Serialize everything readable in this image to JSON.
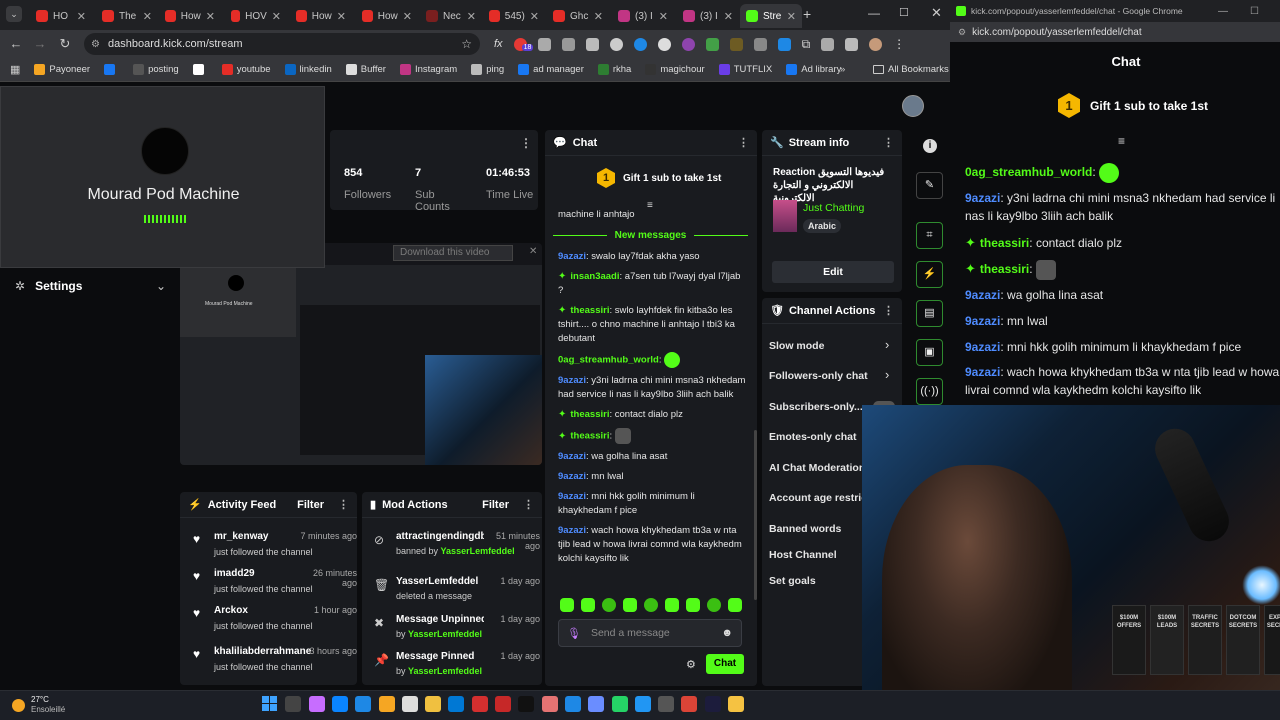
{
  "browser": {
    "tabs": [
      {
        "label": "HO",
        "color": "#e52d27"
      },
      {
        "label": "The",
        "color": "#e52d27"
      },
      {
        "label": "How",
        "color": "#e52d27"
      },
      {
        "label": "HOV",
        "color": "#e52d27"
      },
      {
        "label": "How",
        "color": "#e52d27"
      },
      {
        "label": "How",
        "color": "#e52d27"
      },
      {
        "label": "Nec",
        "color": "#7a1f1f"
      },
      {
        "label": "545)",
        "color": "#e52d27"
      },
      {
        "label": "Ghc",
        "color": "#e52d27"
      },
      {
        "label": "(3) I",
        "color": "#c13584"
      },
      {
        "label": "(3) I",
        "color": "#c13584"
      },
      {
        "label": "Stre",
        "color": "#53fc18"
      }
    ],
    "url": "dashboard.kick.com/stream",
    "bookmarks": [
      {
        "label": "Payoneer",
        "color": "#f5a623"
      },
      {
        "label": "",
        "color": "#1877f2"
      },
      {
        "label": "posting",
        "color": "#555"
      },
      {
        "label": "",
        "color": "#fff"
      },
      {
        "label": "youtube",
        "color": "#e52d27"
      },
      {
        "label": "linkedin",
        "color": "#0a66c2"
      },
      {
        "label": "Buffer",
        "color": "#ddd"
      },
      {
        "label": "Instagram",
        "color": "#c13584"
      },
      {
        "label": "ping",
        "color": "#bbb"
      },
      {
        "label": "ad manager",
        "color": "#1877f2"
      },
      {
        "label": "rkha",
        "color": "#2e7d32"
      },
      {
        "label": "magichour",
        "color": "#333"
      },
      {
        "label": "TUTFLIX",
        "color": "#6a3de8"
      },
      {
        "label": "Ad library",
        "color": "#1877f2"
      }
    ],
    "all_bookmarks": "All Bookmarks",
    "ext_badge": "18"
  },
  "overlay": {
    "name": "Mourad Pod Machine",
    "settings": "Settings"
  },
  "stats": [
    {
      "value": "854",
      "label": "Followers"
    },
    {
      "value": "7",
      "label": "Sub Counts"
    },
    {
      "value": "01:46:53",
      "label": "Time Live"
    }
  ],
  "preview": {
    "download": "Download this video"
  },
  "chat": {
    "title": "Chat",
    "gift": "Gift 1 sub to take 1st",
    "gift_rank": "1",
    "cut_line": "machine li anhtajo",
    "new_messages": "New messages",
    "messages": [
      {
        "user": "9azazi",
        "color": "#4f8cff",
        "badge": false,
        "text": "swalo lay7fdak akha yaso"
      },
      {
        "user": "insan3aadi",
        "color": "#53fc18",
        "badge": true,
        "text": "a7sen tub l7wayj dyal l7ljab ?"
      },
      {
        "user": "theassiri",
        "color": "#53fc18",
        "badge": true,
        "text": "swlo layhfdek fin kitba3o les tshirt.... o chno machine li anhtajo l tbi3 ka debutant"
      },
      {
        "user": "0ag_streamhub_world",
        "color": "#53fc18",
        "badge": false,
        "text": ""
      },
      {
        "user": "9azazi",
        "color": "#4f8cff",
        "badge": false,
        "text": "y3ni ladrna chi mini msna3 nkhedam had service li nas li kay9lbo 3liih ach balik"
      },
      {
        "user": "theassiri",
        "color": "#53fc18",
        "badge": true,
        "text": "contact dialo plz"
      },
      {
        "user": "theassiri",
        "color": "#53fc18",
        "badge": true,
        "text": ""
      },
      {
        "user": "9azazi",
        "color": "#4f8cff",
        "badge": false,
        "text": "wa golha lina asat"
      },
      {
        "user": "9azazi",
        "color": "#4f8cff",
        "badge": false,
        "text": "mn lwal"
      },
      {
        "user": "9azazi",
        "color": "#4f8cff",
        "badge": false,
        "text": "mni hkk golih minimum li khaykhedam f pice"
      },
      {
        "user": "9azazi",
        "color": "#4f8cff",
        "badge": false,
        "text": "wach howa khykhedam tb3a w nta tjib lead w howa livrai comnd wla kaykhedm kolchi kaysifto lik"
      }
    ],
    "placeholder": "Send a message",
    "send": "Chat"
  },
  "stream_info": {
    "title": "Stream info",
    "stream_title": "Reaction فيديوها التسويق الالكتروني و التجارة الالكترونية",
    "category": "Just Chatting",
    "language": "Arabic",
    "edit": "Edit"
  },
  "channel_actions": {
    "title": "Channel Actions",
    "items": [
      "Slow mode",
      "Followers-only chat",
      "Subscribers-only...",
      "Emotes-only chat",
      "AI Chat Moderation",
      "Account age restric",
      "Banned words",
      "Host Channel",
      "Set goals"
    ]
  },
  "activity": {
    "title": "Activity Feed",
    "filter": "Filter",
    "rows": [
      {
        "name": "mr_kenway",
        "time": "7 minutes ago",
        "sub": "just followed the channel"
      },
      {
        "name": "imadd29",
        "time": "26 minutes ago",
        "sub": "just followed the channel"
      },
      {
        "name": "Arckox",
        "time": "1 hour ago",
        "sub": "just followed the channel"
      },
      {
        "name": "khaliliabderrahmane",
        "time": "3 hours ago",
        "sub": "just followed the channel"
      }
    ]
  },
  "mod": {
    "title": "Mod Actions",
    "filter": "Filter",
    "rows": [
      {
        "name": "attractingendingdb",
        "time": "51 minutes ago",
        "pre": "banned by ",
        "by": "YasserLemfeddel",
        "icon": "ban"
      },
      {
        "name": "YasserLemfeddel",
        "time": "1 day ago",
        "pre": "deleted a message",
        "by": "",
        "icon": "trash"
      },
      {
        "name": "Message Unpinned",
        "time": "1 day ago",
        "pre": "by ",
        "by": "YasserLemfeddel",
        "icon": "unpin"
      },
      {
        "name": "Message Pinned",
        "time": "1 day ago",
        "pre": "by ",
        "by": "YasserLemfeddel",
        "icon": "pin"
      }
    ]
  },
  "popout": {
    "window_title": "kick.com/popout/yasserlemfeddel/chat - Google Chrome",
    "url": "kick.com/popout/yasserlemfeddel/chat",
    "header": "Chat",
    "gift": "Gift 1 sub to take 1st",
    "gift_rank": "1",
    "messages": [
      {
        "user": "0ag_streamhub_world",
        "color": "#53fc18",
        "badge": false,
        "text": ""
      },
      {
        "user": "9azazi",
        "color": "#4f8cff",
        "badge": false,
        "text": "y3ni ladrna chi mini msna3 nkhedam had service li nas li kay9lbo 3liih ach balik"
      },
      {
        "user": "theassiri",
        "color": "#53fc18",
        "badge": true,
        "text": "contact dialo plz"
      },
      {
        "user": "theassiri",
        "color": "#53fc18",
        "badge": true,
        "text": ""
      },
      {
        "user": "9azazi",
        "color": "#4f8cff",
        "badge": false,
        "text": "wa golha lina asat"
      },
      {
        "user": "9azazi",
        "color": "#4f8cff",
        "badge": false,
        "text": "mn lwal"
      },
      {
        "user": "9azazi",
        "color": "#4f8cff",
        "badge": false,
        "text": "mni hkk golih minimum li khaykhedam f pice"
      },
      {
        "user": "9azazi",
        "color": "#4f8cff",
        "badge": false,
        "text": "wach howa khykhedam tb3a w nta tjib lead w howa livrai comnd wla kaykhedm kolchi kaysifto lik"
      }
    ]
  },
  "webcam": {
    "books": [
      "$100M OFFERS",
      "$100M LEADS",
      "TRAFFIC SECRETS",
      "DOTCOM SECRETS",
      "EXPERT SECRETS"
    ]
  },
  "taskbar": {
    "temp": "27°C",
    "weather": "Ensoleillé"
  }
}
